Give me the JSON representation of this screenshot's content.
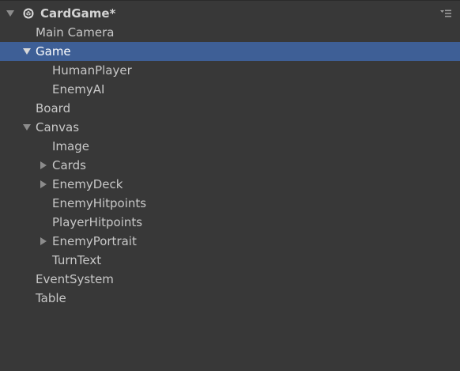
{
  "scene": {
    "title": "CardGame*",
    "icon": "unity-scene-icon",
    "menu_icon": "hamburger-menu-icon"
  },
  "items": [
    {
      "label": "Main Camera"
    },
    {
      "label": "Game"
    },
    {
      "label": "HumanPlayer"
    },
    {
      "label": "EnemyAI"
    },
    {
      "label": "Board"
    },
    {
      "label": "Canvas"
    },
    {
      "label": "Image"
    },
    {
      "label": "Cards"
    },
    {
      "label": "EnemyDeck"
    },
    {
      "label": "EnemyHitpoints"
    },
    {
      "label": "PlayerHitpoints"
    },
    {
      "label": "EnemyPortrait"
    },
    {
      "label": "TurnText"
    },
    {
      "label": "EventSystem"
    },
    {
      "label": "Table"
    }
  ],
  "colors": {
    "background": "#383838",
    "selection": "#3e5f96",
    "text": "#c8c8c8"
  }
}
